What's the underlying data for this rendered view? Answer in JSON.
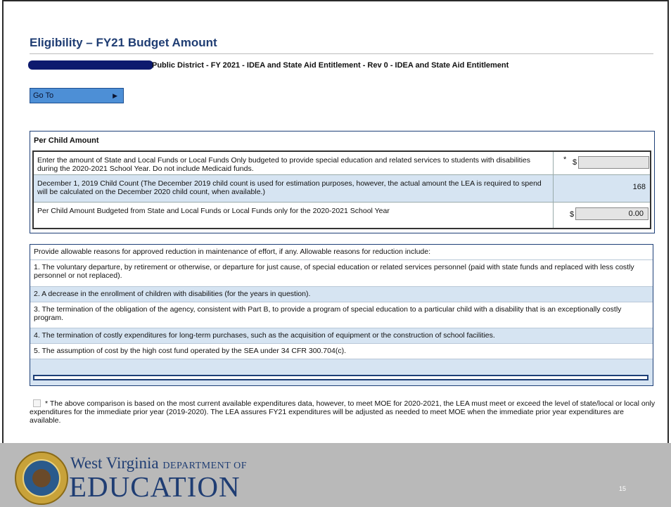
{
  "page": {
    "title": "Eligibility – FY21 Budget Amount",
    "subtitle": "Public District - FY 2021 - IDEA and State Aid Entitlement - Rev 0 - IDEA and State Aid Entitlement"
  },
  "goto": {
    "label": "Go To",
    "arrow": "▶"
  },
  "per_child": {
    "header": "Per Child Amount",
    "rows": [
      {
        "label": "Enter the amount of State and Local Funds or Local Funds Only budgeted to provide special education and related services to students with disabilities during the 2020-2021 School Year. Do not include Medicaid funds.",
        "required_mark": "*",
        "currency": "$",
        "value": ""
      },
      {
        "label": "December 1, 2019 Child Count (The December 2019 child count is used for estimation purposes, however, the actual amount the LEA is required to spend will be calculated on the December 2020 child count, when available.)",
        "value": "168"
      },
      {
        "label": "Per Child Amount Budgeted from State and Local Funds or Local Funds only for the 2020-2021 School Year",
        "currency": "$",
        "value": "0.00"
      }
    ]
  },
  "reasons": {
    "intro": "Provide allowable reasons for approved reduction in maintenance of effort, if any. Allowable reasons for reduction include:",
    "items": [
      "1. The voluntary departure, by retirement or otherwise, or departure for just cause, of special education or related services personnel (paid with state funds and replaced with less costly personnel or not replaced).",
      "2. A decrease in the enrollment of children with disabilities (for the years in question).",
      "3. The termination of the obligation of the agency, consistent with Part B, to provide a program of special education to a particular child with a disability that is an exceptionally costly program.",
      "4. The termination of costly expenditures for long-term purchases, such as the acquisition of equipment or the construction of school facilities.",
      "5. The assumption of cost by the high cost fund operated by the SEA under 34 CFR 300.704(c)."
    ]
  },
  "assurance": {
    "text": "* The above comparison is based on the most current available expenditures data, however, to meet MOE for 2020-2021, the LEA must meet or exceed the level of state/local or local only expenditures for the immediate prior year (2019-2020). The LEA assures FY21 expenditures will be adjusted as needed to meet MOE when the immediate prior year expenditures are available."
  },
  "footer": {
    "brand_line1": "West Virginia",
    "brand_line1b": "DEPARTMENT OF",
    "brand_line2": "EDUCATION",
    "page_number": "15",
    "seal_icon": "state-seal-icon",
    "band_color": "#b9b9b9",
    "brand_color": "#1f3d73"
  }
}
